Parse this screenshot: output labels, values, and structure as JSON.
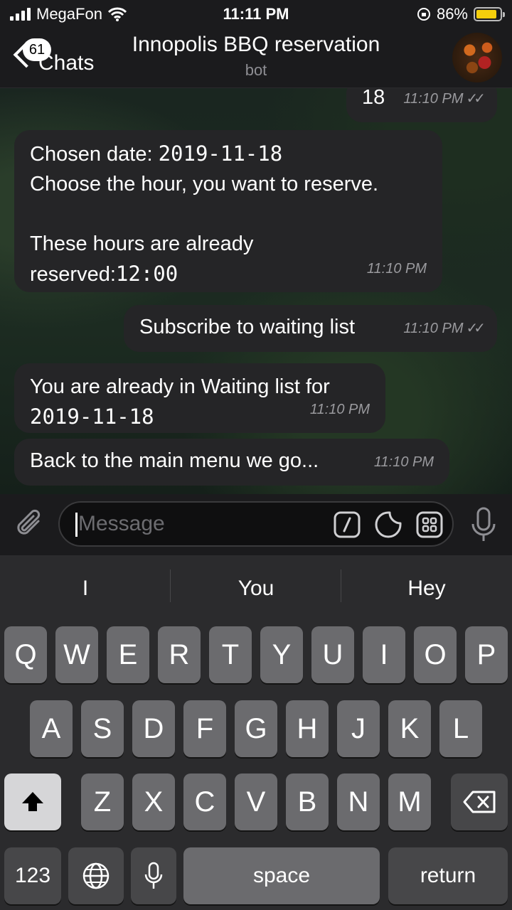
{
  "status": {
    "carrier": "MegaFon",
    "time": "11:11 PM",
    "battery": "86%",
    "battery_level": 0.86
  },
  "header": {
    "back_badge": "61",
    "back_label": "Chats",
    "title": "Innopolis BBQ reservation",
    "subtitle": "bot",
    "avatar_icon": "bbq-avatar-icon"
  },
  "messages": [
    {
      "direction": "out",
      "text": "18",
      "time": "11:10 PM",
      "read": "✓✓"
    },
    {
      "direction": "in",
      "line1_prefix": "Chosen date: ",
      "date": "2019-11-18",
      "line2": "Choose the hour, you want to reserve.",
      "line3": "These hours are already",
      "line4_prefix": "reserved:",
      "hour": "12:00",
      "time": "11:10 PM"
    },
    {
      "direction": "out",
      "text": "Subscribe to waiting list",
      "time": "11:10 PM",
      "read": "✓✓"
    },
    {
      "direction": "in",
      "line1": "You are already in Waiting list for",
      "date": "2019-11-18",
      "time": "11:10 PM"
    },
    {
      "direction": "in",
      "text": "Back to the main menu we go...",
      "time": "11:10 PM"
    }
  ],
  "input": {
    "placeholder": "Message",
    "icons": [
      "attach-icon",
      "commands-icon",
      "sticker-icon",
      "inline-keyboard-icon",
      "microphone-icon"
    ]
  },
  "keyboard": {
    "suggestions": [
      "I",
      "You",
      "Hey"
    ],
    "row1": [
      "Q",
      "W",
      "E",
      "R",
      "T",
      "Y",
      "U",
      "I",
      "O",
      "P"
    ],
    "row2": [
      "A",
      "S",
      "D",
      "F",
      "G",
      "H",
      "J",
      "K",
      "L"
    ],
    "row3": [
      "Z",
      "X",
      "C",
      "V",
      "B",
      "N",
      "M"
    ],
    "numbers": "123",
    "space": "space",
    "return": "return"
  }
}
